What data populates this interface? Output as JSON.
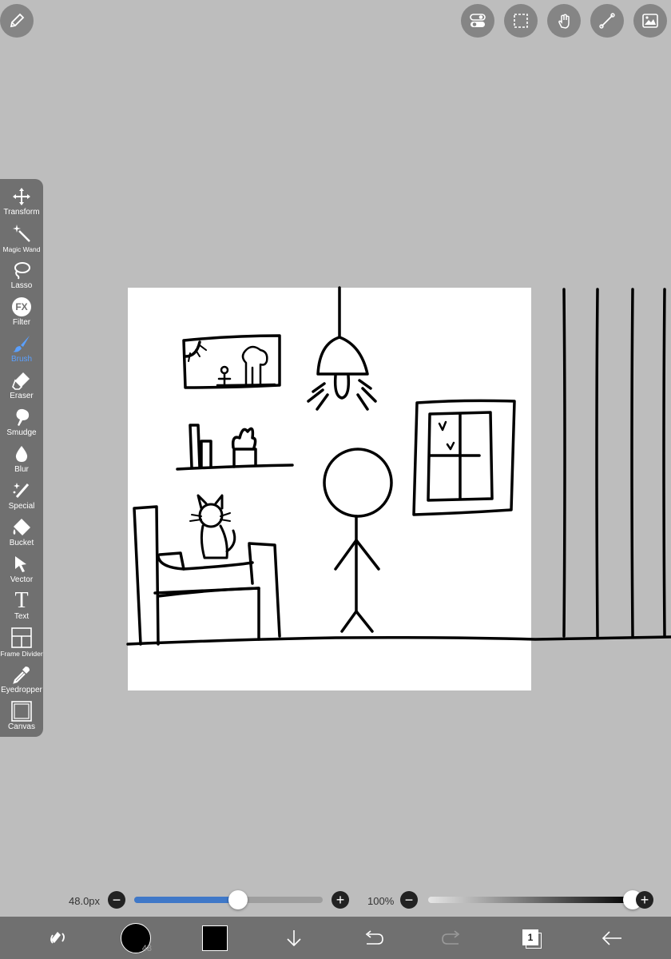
{
  "tools": [
    {
      "label": "Transform",
      "icon": "transform-icon"
    },
    {
      "label": "Magic Wand",
      "icon": "magic-wand-icon"
    },
    {
      "label": "Lasso",
      "icon": "lasso-icon"
    },
    {
      "label": "Filter",
      "icon": "filter-icon",
      "glyph": "FX"
    },
    {
      "label": "Brush",
      "icon": "brush-icon",
      "active": true
    },
    {
      "label": "Eraser",
      "icon": "eraser-icon"
    },
    {
      "label": "Smudge",
      "icon": "smudge-icon"
    },
    {
      "label": "Blur",
      "icon": "blur-icon"
    },
    {
      "label": "Special",
      "icon": "special-icon"
    },
    {
      "label": "Bucket",
      "icon": "bucket-icon"
    },
    {
      "label": "Vector",
      "icon": "vector-icon"
    },
    {
      "label": "Text",
      "icon": "text-icon",
      "glyph": "T"
    },
    {
      "label": "Frame Divider",
      "icon": "frame-divider-icon"
    },
    {
      "label": "Eyedropper",
      "icon": "eyedropper-icon"
    },
    {
      "label": "Canvas",
      "icon": "canvas-icon"
    }
  ],
  "brush": {
    "size_label": "48.0px",
    "size_fraction": 0.55,
    "color_badge": "48"
  },
  "opacity": {
    "label": "100%",
    "fraction": 1.0
  },
  "colors": {
    "active_tool": "#5aa0ff",
    "slider_fill": "#3f78c8",
    "panel": "#707070",
    "background": "#bdbdbd",
    "primary_color": "#000000"
  },
  "layers": {
    "count": "1"
  }
}
